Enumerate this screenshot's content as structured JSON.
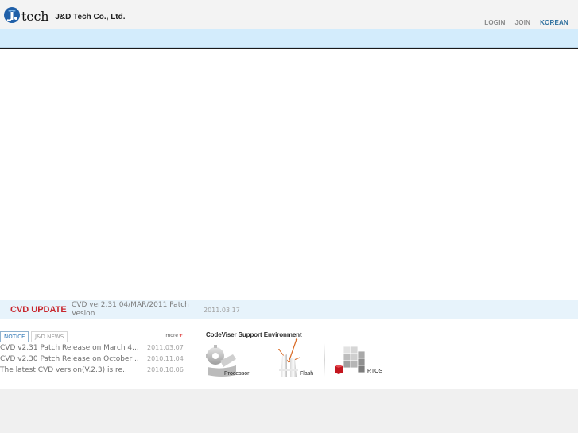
{
  "header": {
    "logo_text": "tech",
    "company_name": "J&D Tech Co., Ltd.",
    "nav": [
      {
        "label": "LOGIN"
      },
      {
        "label": "JOIN"
      },
      {
        "label": "KOREAN"
      }
    ]
  },
  "update": {
    "label": "CVD UPDATE",
    "text": "CVD ver2.31 04/MAR/2011 Patch Vesion",
    "date": "2011.03.17"
  },
  "news": {
    "tabs": [
      {
        "label": "NOTICE",
        "active": true
      },
      {
        "label": "J&D NEWS",
        "active": false
      }
    ],
    "more_label": "more",
    "more_plus": "+",
    "items": [
      {
        "title": "CVD v2.31 Patch Release on March 4...",
        "date": "2011.03.07"
      },
      {
        "title": "CVD v2.30 Patch Release on October ..",
        "date": "2010.11.04"
      },
      {
        "title": "The latest CVD version(V.2.3) is re..",
        "date": "2010.10.06"
      }
    ]
  },
  "support": {
    "title": "CodeViser Support Environment",
    "items": [
      {
        "label": "Processor",
        "icon": "processor-icon"
      },
      {
        "label": "Flash",
        "icon": "flash-icon"
      },
      {
        "label": "RTOS",
        "icon": "rtos-icon"
      }
    ]
  },
  "colors": {
    "menubar": "#d3ecfc",
    "update_label": "#c8272e",
    "nav_active": "#2d6f9e",
    "tab_active": "#2f77b6"
  }
}
